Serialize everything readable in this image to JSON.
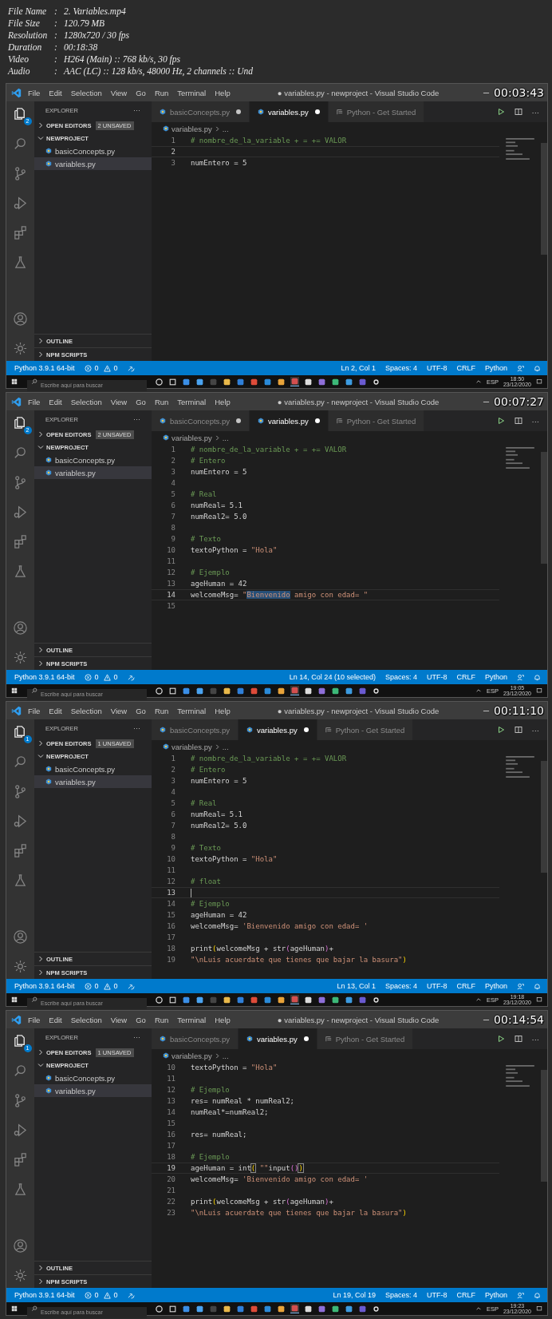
{
  "video_info": [
    {
      "label": "File Name",
      "separator": ":",
      "value": "2. Variables.mp4"
    },
    {
      "label": "File Size",
      "separator": ":",
      "value": "120.79 MB"
    },
    {
      "label": "Resolution",
      "separator": ":",
      "value": "1280x720 / 30 fps"
    },
    {
      "label": "Duration",
      "separator": ":",
      "value": "00:18:38"
    },
    {
      "label": "Video",
      "separator": ":",
      "value": "H264 (Main) :: 768 kb/s, 30 fps"
    },
    {
      "label": "Audio",
      "separator": ":",
      "value": "AAC (LC) :: 128 kb/s, 48000 Hz, 2 channels :: Und"
    }
  ],
  "frames": [
    {
      "timestamp": "00:03:43",
      "title": "● variables.py - newproject - Visual Studio Code",
      "menu": [
        "File",
        "Edit",
        "Selection",
        "View",
        "Go",
        "Run",
        "Terminal",
        "Help"
      ],
      "explorer_badge": "2",
      "explorer_title": "EXPLORER",
      "explorer_more": "···",
      "sections": [
        {
          "label": "OPEN EDITORS",
          "expanded": false,
          "badge": "2 UNSAVED"
        },
        {
          "label": "NEWPROJECT",
          "expanded": true
        }
      ],
      "files": [
        {
          "name": "basicConcepts.py",
          "selected": false
        },
        {
          "name": "variables.py",
          "selected": true
        }
      ],
      "bottom_sections": [
        {
          "label": "OUTLINE",
          "expanded": false
        },
        {
          "label": "NPM SCRIPTS",
          "expanded": false
        }
      ],
      "tabs": [
        {
          "label": "basicConcepts.py",
          "kind": "python",
          "selected": false,
          "dirty": true
        },
        {
          "label": "variables.py",
          "kind": "python",
          "selected": true,
          "dirty": true
        },
        {
          "label": "Python - Get Started",
          "kind": "welcome",
          "selected": false,
          "dirty": false
        }
      ],
      "tab_more": "···",
      "breadcrumb": {
        "file": "variables.py",
        "rest": "..."
      },
      "lines": [
        {
          "number": "1",
          "current": false,
          "tokens": [
            {
              "text": "# nombre_de_la_variable + = += VALOR",
              "kind": "comment"
            }
          ]
        },
        {
          "number": "2",
          "current": true
        },
        {
          "number": "3",
          "current": false,
          "tokens": [
            {
              "text": "numEntero = 5",
              "kind": "code"
            }
          ]
        }
      ],
      "status": {
        "interpreter": "Python 3.9.1 64-bit",
        "errors": "0",
        "warnings": "0",
        "position": "Ln 2, Col 1",
        "spaces": "Spaces: 4",
        "encoding": "UTF-8",
        "eol": "CRLF",
        "language": "Python"
      },
      "taskbar": {
        "search_placeholder": "Escribe aquí para buscar",
        "language": "ESP",
        "time": "18:50",
        "date": "23/12/2020"
      }
    },
    {
      "timestamp": "00:07:27",
      "title": "● variables.py - newproject - Visual Studio Code",
      "menu": [
        "File",
        "Edit",
        "Selection",
        "View",
        "Go",
        "Run",
        "Terminal",
        "Help"
      ],
      "explorer_badge": "2",
      "explorer_title": "EXPLORER",
      "explorer_more": "···",
      "sections": [
        {
          "label": "OPEN EDITORS",
          "expanded": false,
          "badge": "2 UNSAVED"
        },
        {
          "label": "NEWPROJECT",
          "expanded": true
        }
      ],
      "files": [
        {
          "name": "basicConcepts.py",
          "selected": false
        },
        {
          "name": "variables.py",
          "selected": true
        }
      ],
      "bottom_sections": [
        {
          "label": "OUTLINE",
          "expanded": false
        },
        {
          "label": "NPM SCRIPTS",
          "expanded": false
        }
      ],
      "tabs": [
        {
          "label": "basicConcepts.py",
          "kind": "python",
          "selected": false,
          "dirty": true
        },
        {
          "label": "variables.py",
          "kind": "python",
          "selected": true,
          "dirty": true
        },
        {
          "label": "Python - Get Started",
          "kind": "welcome",
          "selected": false,
          "dirty": false
        }
      ],
      "tab_more": "···",
      "breadcrumb": {
        "file": "variables.py",
        "rest": "..."
      },
      "lines": [
        {
          "number": "1",
          "current": false,
          "tokens": [
            {
              "text": "# nombre_de_la_variable + = += VALOR",
              "kind": "comment"
            }
          ]
        },
        {
          "number": "2",
          "current": false,
          "tokens": [
            {
              "text": "# Entero",
              "kind": "comment"
            }
          ]
        },
        {
          "number": "3",
          "current": false,
          "tokens": [
            {
              "text": "numEntero = 5",
              "kind": "code"
            }
          ]
        },
        {
          "number": "4",
          "current": false
        },
        {
          "number": "5",
          "current": false,
          "tokens": [
            {
              "text": "# Real",
              "kind": "comment"
            }
          ]
        },
        {
          "number": "6",
          "current": false,
          "tokens": [
            {
              "text": "numReal= 5.1",
              "kind": "code"
            }
          ]
        },
        {
          "number": "7",
          "current": false,
          "tokens": [
            {
              "text": "numReal2= 5.0",
              "kind": "code"
            }
          ]
        },
        {
          "number": "8",
          "current": false
        },
        {
          "number": "9",
          "current": false,
          "tokens": [
            {
              "text": "# Texto",
              "kind": "comment"
            }
          ]
        },
        {
          "number": "10",
          "current": false,
          "tokens": [
            {
              "text": "textoPython = ",
              "kind": "code"
            },
            {
              "text": "\"Hola\"",
              "kind": "string"
            }
          ]
        },
        {
          "number": "11",
          "current": false
        },
        {
          "number": "12",
          "current": false,
          "tokens": [
            {
              "text": "# Ejemplo",
              "kind": "comment"
            }
          ]
        },
        {
          "number": "13",
          "current": false,
          "tokens": [
            {
              "text": "ageHuman = 42",
              "kind": "code"
            }
          ]
        },
        {
          "number": "14",
          "current": true,
          "tokens": [
            {
              "text": "welcomeMsg= ",
              "kind": "code"
            },
            {
              "text": "\"",
              "kind": "string"
            },
            {
              "text": "Bienvenido",
              "kind": "selection"
            },
            {
              "text": " amigo con edad= \"",
              "kind": "string"
            }
          ]
        },
        {
          "number": "15",
          "current": false
        }
      ],
      "status": {
        "interpreter": "Python 3.9.1 64-bit",
        "errors": "0",
        "warnings": "0",
        "position": "Ln 14, Col 24 (10 selected)",
        "spaces": "Spaces: 4",
        "encoding": "UTF-8",
        "eol": "CRLF",
        "language": "Python"
      },
      "taskbar": {
        "search_placeholder": "Escribe aquí para buscar",
        "language": "ESP",
        "time": "19:05",
        "date": "23/12/2020"
      }
    },
    {
      "timestamp": "00:11:10",
      "title": "● variables.py - newproject - Visual Studio Code",
      "menu": [
        "File",
        "Edit",
        "Selection",
        "View",
        "Go",
        "Run",
        "Terminal",
        "Help"
      ],
      "explorer_badge": "1",
      "explorer_title": "EXPLORER",
      "explorer_more": "···",
      "sections": [
        {
          "label": "OPEN EDITORS",
          "expanded": false,
          "badge": "1 UNSAVED"
        },
        {
          "label": "NEWPROJECT",
          "expanded": true
        }
      ],
      "files": [
        {
          "name": "basicConcepts.py",
          "selected": false
        },
        {
          "name": "variables.py",
          "selected": true
        }
      ],
      "bottom_sections": [
        {
          "label": "OUTLINE",
          "expanded": false
        },
        {
          "label": "NPM SCRIPTS",
          "expanded": false
        }
      ],
      "tabs": [
        {
          "label": "basicConcepts.py",
          "kind": "python",
          "selected": false,
          "dirty": false
        },
        {
          "label": "variables.py",
          "kind": "python",
          "selected": true,
          "dirty": true
        },
        {
          "label": "Python - Get Started",
          "kind": "welcome",
          "selected": false,
          "dirty": false
        }
      ],
      "tab_more": "···",
      "breadcrumb": {
        "file": "variables.py",
        "rest": "..."
      },
      "lines": [
        {
          "number": "1",
          "current": false,
          "tokens": [
            {
              "text": "# nombre_de_la_variable + = += VALOR",
              "kind": "comment"
            }
          ]
        },
        {
          "number": "2",
          "current": false,
          "tokens": [
            {
              "text": "# Entero",
              "kind": "comment"
            }
          ]
        },
        {
          "number": "3",
          "current": false,
          "tokens": [
            {
              "text": "numEntero = 5",
              "kind": "code"
            }
          ]
        },
        {
          "number": "4",
          "current": false
        },
        {
          "number": "5",
          "current": false,
          "tokens": [
            {
              "text": "# Real",
              "kind": "comment"
            }
          ]
        },
        {
          "number": "6",
          "current": false,
          "tokens": [
            {
              "text": "numReal= 5.1",
              "kind": "code"
            }
          ]
        },
        {
          "number": "7",
          "current": false,
          "tokens": [
            {
              "text": "numReal2= 5.0",
              "kind": "code"
            }
          ]
        },
        {
          "number": "8",
          "current": false
        },
        {
          "number": "9",
          "current": false,
          "tokens": [
            {
              "text": "# Texto",
              "kind": "comment"
            }
          ]
        },
        {
          "number": "10",
          "current": false,
          "tokens": [
            {
              "text": "textoPython = ",
              "kind": "code"
            },
            {
              "text": "\"Hola\"",
              "kind": "string"
            }
          ]
        },
        {
          "number": "11",
          "current": false
        },
        {
          "number": "12",
          "current": false,
          "tokens": [
            {
              "text": "# float",
              "kind": "comment"
            }
          ]
        },
        {
          "number": "13",
          "current": true,
          "caret": true
        },
        {
          "number": "14",
          "current": false,
          "tokens": [
            {
              "text": "# Ejemplo",
              "kind": "comment"
            }
          ]
        },
        {
          "number": "15",
          "current": false,
          "tokens": [
            {
              "text": "ageHuman = 42",
              "kind": "code"
            }
          ]
        },
        {
          "number": "16",
          "current": false,
          "tokens": [
            {
              "text": "welcomeMsg= ",
              "kind": "code"
            },
            {
              "text": "'Bienvenido amigo con edad= '",
              "kind": "string"
            }
          ]
        },
        {
          "number": "17",
          "current": false
        },
        {
          "number": "18",
          "current": false,
          "tokens": [
            {
              "text": "print",
              "kind": "code"
            },
            {
              "text": "(",
              "kind": "bracket"
            },
            {
              "text": "welcomeMsg + str",
              "kind": "code"
            },
            {
              "text": "(",
              "kind": "bracket2"
            },
            {
              "text": "ageHuman",
              "kind": "code"
            },
            {
              "text": ")",
              "kind": "bracket2"
            },
            {
              "text": "+",
              "kind": "code"
            }
          ]
        },
        {
          "number": "19",
          "current": false,
          "tokens": [
            {
              "text": "\"\\nLuis acuerdate que tienes que bajar la basura\"",
              "kind": "string"
            },
            {
              "text": ")",
              "kind": "bracket"
            }
          ]
        }
      ],
      "status": {
        "interpreter": "Python 3.9.1 64-bit",
        "errors": "0",
        "warnings": "0",
        "position": "Ln 13, Col 1",
        "spaces": "Spaces: 4",
        "encoding": "UTF-8",
        "eol": "CRLF",
        "language": "Python"
      },
      "taskbar": {
        "search_placeholder": "Escribe aquí para buscar",
        "language": "ESP",
        "time": "19:18",
        "date": "23/12/2020"
      }
    },
    {
      "timestamp": "00:14:54",
      "title": "● variables.py - newproject - Visual Studio Code",
      "menu": [
        "File",
        "Edit",
        "Selection",
        "View",
        "Go",
        "Run",
        "Terminal",
        "Help"
      ],
      "explorer_badge": "1",
      "explorer_title": "EXPLORER",
      "explorer_more": "···",
      "sections": [
        {
          "label": "OPEN EDITORS",
          "expanded": false,
          "badge": "1 UNSAVED"
        },
        {
          "label": "NEWPROJECT",
          "expanded": true
        }
      ],
      "files": [
        {
          "name": "basicConcepts.py",
          "selected": false
        },
        {
          "name": "variables.py",
          "selected": true
        }
      ],
      "bottom_sections": [
        {
          "label": "OUTLINE",
          "expanded": false
        },
        {
          "label": "NPM SCRIPTS",
          "expanded": false
        }
      ],
      "tabs": [
        {
          "label": "basicConcepts.py",
          "kind": "python",
          "selected": false,
          "dirty": false
        },
        {
          "label": "variables.py",
          "kind": "python",
          "selected": true,
          "dirty": true
        },
        {
          "label": "Python - Get Started",
          "kind": "welcome",
          "selected": false,
          "dirty": false
        }
      ],
      "tab_more": "···",
      "breadcrumb": {
        "file": "variables.py",
        "rest": "..."
      },
      "lines": [
        {
          "number": "10",
          "current": false,
          "tokens": [
            {
              "text": "textoPython = ",
              "kind": "code"
            },
            {
              "text": "\"Hola\"",
              "kind": "string"
            }
          ]
        },
        {
          "number": "11",
          "current": false
        },
        {
          "number": "12",
          "current": false,
          "tokens": [
            {
              "text": "# Ejemplo",
              "kind": "comment"
            }
          ]
        },
        {
          "number": "13",
          "current": false,
          "tokens": [
            {
              "text": "res= numReal * numReal2;",
              "kind": "code"
            }
          ]
        },
        {
          "number": "14",
          "current": false,
          "tokens": [
            {
              "text": "numReal*=numReal2;",
              "kind": "code"
            }
          ]
        },
        {
          "number": "15",
          "current": false
        },
        {
          "number": "16",
          "current": false,
          "tokens": [
            {
              "text": "res= numReal;",
              "kind": "code"
            }
          ]
        },
        {
          "number": "17",
          "current": false
        },
        {
          "number": "18",
          "current": false,
          "tokens": [
            {
              "text": "# Ejemplo",
              "kind": "comment"
            }
          ]
        },
        {
          "number": "19",
          "current": true,
          "tokens": [
            {
              "text": "ageHuman = int",
              "kind": "code"
            },
            {
              "text": "(",
              "kind": "matched"
            },
            {
              "text": " \"\"",
              "kind": "string"
            },
            {
              "text": "input",
              "kind": "code"
            },
            {
              "text": "()",
              "kind": "bracket2"
            },
            {
              "text": ")",
              "kind": "matched"
            }
          ]
        },
        {
          "number": "20",
          "current": false,
          "tokens": [
            {
              "text": "welcomeMsg= ",
              "kind": "code"
            },
            {
              "text": "'Bienvenido amigo con edad= '",
              "kind": "string"
            }
          ]
        },
        {
          "number": "21",
          "current": false
        },
        {
          "number": "22",
          "current": false,
          "tokens": [
            {
              "text": "print",
              "kind": "code"
            },
            {
              "text": "(",
              "kind": "bracket"
            },
            {
              "text": "welcomeMsg + str",
              "kind": "code"
            },
            {
              "text": "(",
              "kind": "bracket2"
            },
            {
              "text": "ageHuman",
              "kind": "code"
            },
            {
              "text": ")",
              "kind": "bracket2"
            },
            {
              "text": "+",
              "kind": "code"
            }
          ]
        },
        {
          "number": "23",
          "current": false,
          "tokens": [
            {
              "text": "\"\\nLuis acuerdate que tienes que bajar la basura\"",
              "kind": "string"
            },
            {
              "text": ")",
              "kind": "bracket"
            }
          ]
        }
      ],
      "status": {
        "interpreter": "Python 3.9.1 64-bit",
        "errors": "0",
        "warnings": "0",
        "position": "Ln 19, Col 19",
        "spaces": "Spaces: 4",
        "encoding": "UTF-8",
        "eol": "CRLF",
        "language": "Python"
      },
      "taskbar": {
        "search_placeholder": "Escribe aquí para buscar",
        "language": "ESP",
        "time": "19:23",
        "date": "23/12/2020"
      }
    }
  ]
}
